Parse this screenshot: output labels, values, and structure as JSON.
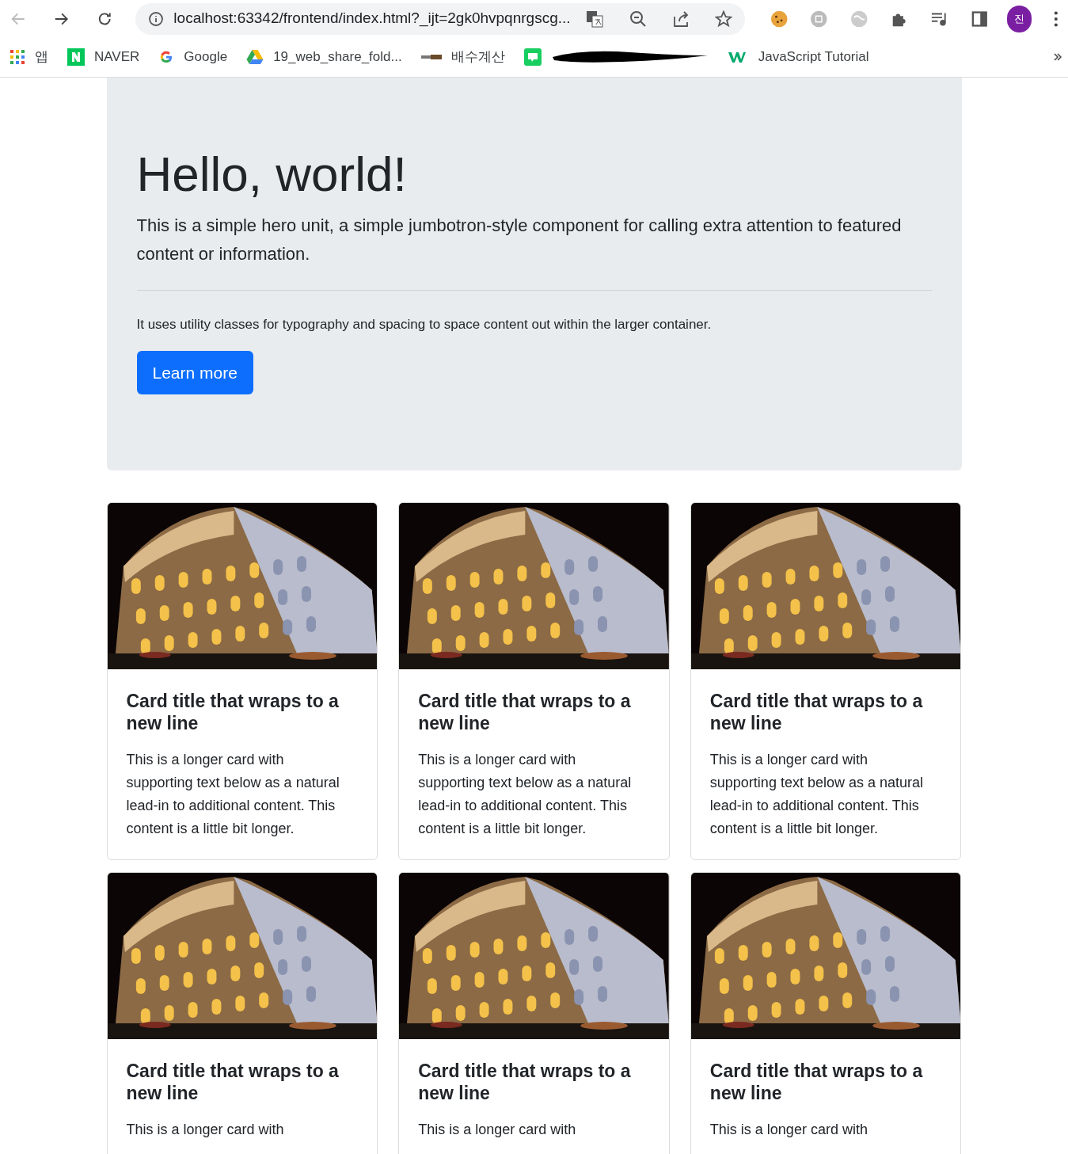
{
  "browser": {
    "url": "localhost:63342/frontend/index.html?_ijt=2gk0hvpqnrgscg...",
    "profile": "진",
    "bookmarks": [
      {
        "kind": "apps",
        "label": "앱"
      },
      {
        "kind": "naver",
        "label": "NAVER"
      },
      {
        "kind": "google",
        "label": "Google"
      },
      {
        "kind": "drive",
        "label": "19_web_share_fold..."
      },
      {
        "kind": "site",
        "label": "배수계산"
      },
      {
        "kind": "blog"
      },
      {
        "kind": "w3",
        "label": "JavaScript Tutorial"
      }
    ]
  },
  "hero": {
    "title": "Hello, world!",
    "lead": "This is a simple hero unit, a simple jumbotron-style component for calling extra attention to featured content or information.",
    "text": "It uses utility classes for typography and spacing to space content out within the larger container.",
    "button": "Learn more"
  },
  "cards": [
    {
      "kind": "picture",
      "title": "Card title that wraps to a new line",
      "text": "This is a longer card with supporting text below as a natural lead-in to additional content. This content is a little bit longer."
    },
    {
      "kind": "picture",
      "title": "Card title that wraps to a new line",
      "text": "This is a longer card with supporting text below as a natural lead-in to additional content. This content is a little bit longer."
    },
    {
      "kind": "picture",
      "title": "Card title that wraps to a new line",
      "text": "This is a longer card with supporting text below as a natural lead-in to additional content. This content is a little bit longer."
    },
    {
      "kind": "picture",
      "title": "Card title that wraps to a new line",
      "text": "This is a longer card with"
    },
    {
      "kind": "picture",
      "title": "Card title that wraps to a new line",
      "text": "This is a longer card with"
    },
    {
      "kind": "picture",
      "title": "Card title that wraps to a new line",
      "text": "This is a longer card with"
    }
  ]
}
